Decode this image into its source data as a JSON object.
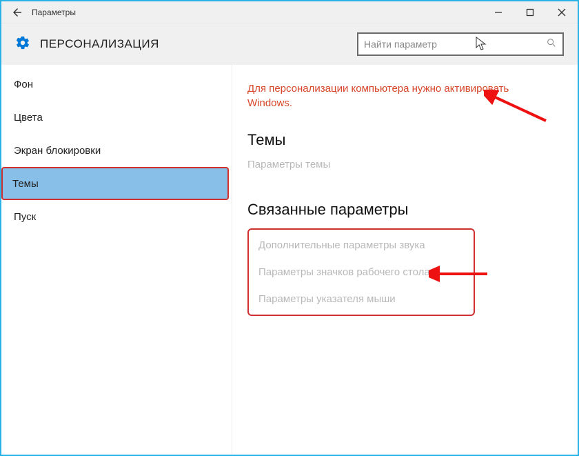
{
  "titlebar": {
    "title": "Параметры"
  },
  "header": {
    "title": "ПЕРСОНАЛИЗАЦИЯ"
  },
  "search": {
    "placeholder": "Найти параметр"
  },
  "sidebar": {
    "items": [
      {
        "label": "Фон"
      },
      {
        "label": "Цвета"
      },
      {
        "label": "Экран блокировки"
      },
      {
        "label": "Темы"
      },
      {
        "label": "Пуск"
      }
    ],
    "selected_index": 3
  },
  "main": {
    "activation_message": "Для персонализации компьютера нужно активировать Windows.",
    "themes_heading": "Темы",
    "themes_link": "Параметры темы",
    "related_heading": "Связанные параметры",
    "related_links": [
      "Дополнительные параметры звука",
      "Параметры значков рабочего стола",
      "Параметры указателя мыши"
    ]
  }
}
